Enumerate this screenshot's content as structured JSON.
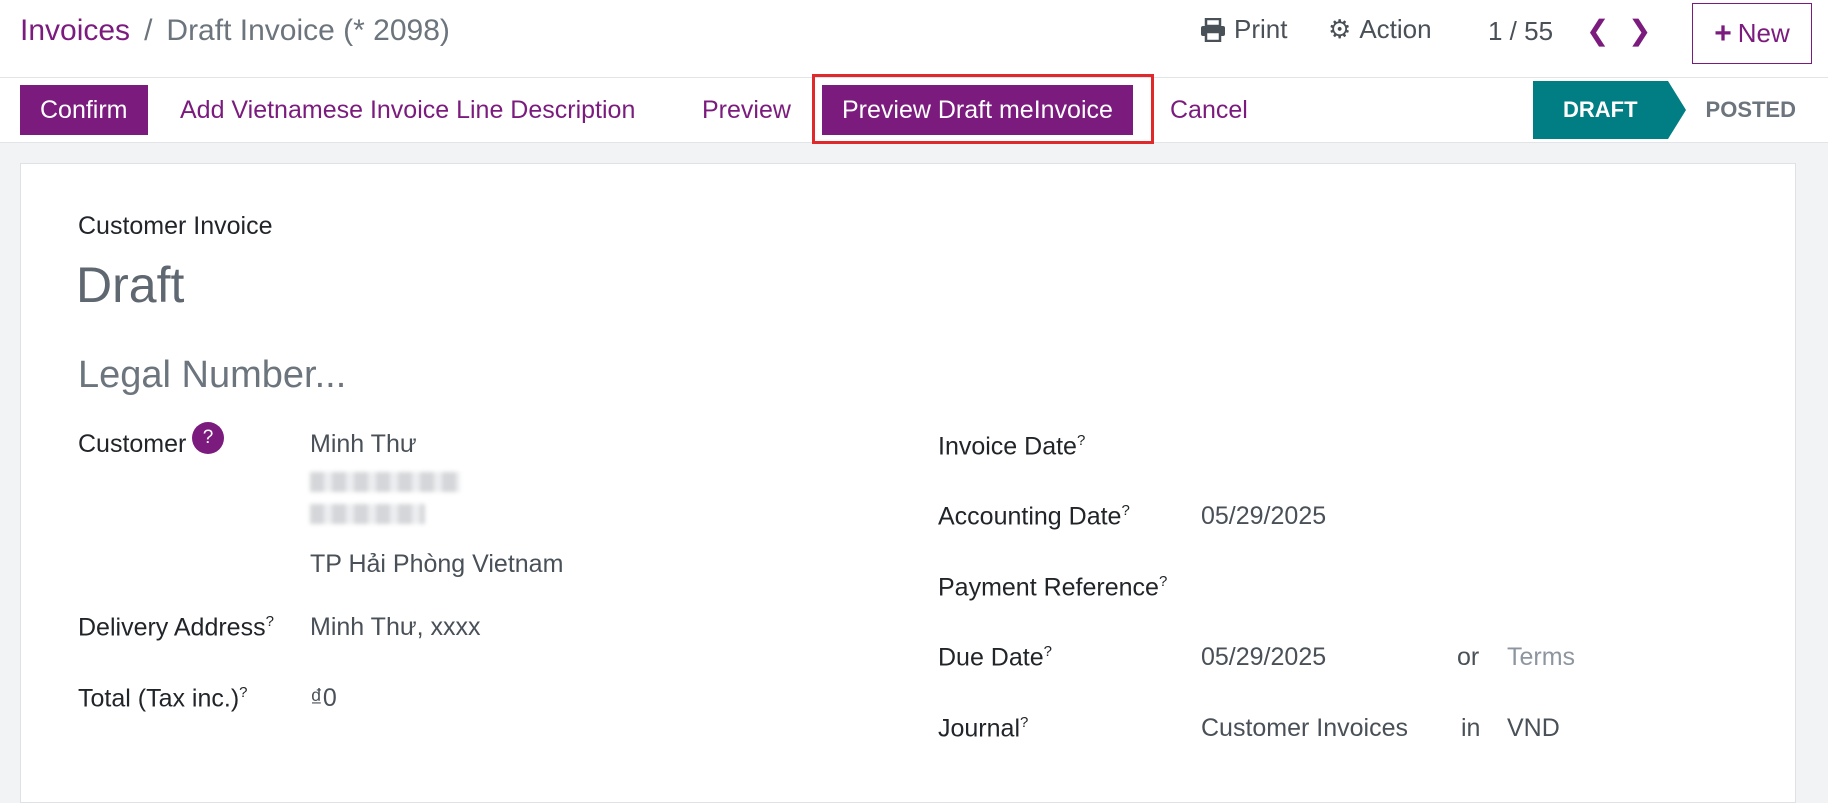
{
  "breadcrumb": {
    "parent": "Invoices",
    "separator": "/",
    "current": "Draft Invoice (* 2098)"
  },
  "toolbar": {
    "print_label": "Print",
    "action_label": "Action",
    "pager": "1 / 55",
    "new_label": "New"
  },
  "statusbar_buttons": {
    "confirm": "Confirm",
    "vn_description": "Add Vietnamese Invoice Line Description",
    "preview": "Preview",
    "preview_draft_me": "Preview Draft meInvoice",
    "cancel": "Cancel"
  },
  "status": {
    "active": "DRAFT",
    "next": "POSTED"
  },
  "form": {
    "doc_type": "Customer Invoice",
    "name": "Draft",
    "legal_placeholder": "Legal Number...",
    "customer_label": "Customer",
    "customer_help": "?",
    "customer_name": "Minh Thư",
    "customer_city": "TP Hải Phòng Vietnam",
    "delivery_label": "Delivery Address",
    "delivery_value": "Minh Thư, xxxx",
    "total_label": "Total (Tax inc.)",
    "total_value": "₫0",
    "invoice_date_label": "Invoice Date",
    "accounting_date_label": "Accounting Date",
    "accounting_date_value": "05/29/2025",
    "payment_ref_label": "Payment Reference",
    "due_date_label": "Due Date",
    "due_date_value": "05/29/2025",
    "or_label": "or",
    "terms_placeholder": "Terms",
    "journal_label": "Journal",
    "journal_value": "Customer Invoices",
    "in_label": "in",
    "currency_value": "VND",
    "help_mark": "?"
  }
}
